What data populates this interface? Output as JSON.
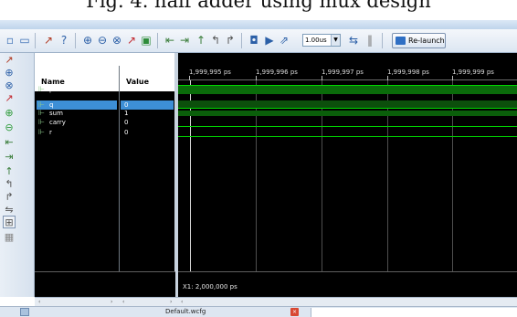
{
  "caption": {
    "text": "Fig. 4. half adder using mux design"
  },
  "toolbar": {
    "zoom_value": "1.00us",
    "relaunch_label": "Re-launch"
  },
  "columns": {
    "name": "Name",
    "value": "Value"
  },
  "signals": [
    {
      "name": "p",
      "value": "1"
    },
    {
      "name": "q",
      "value": "0"
    },
    {
      "name": "sum",
      "value": "1"
    },
    {
      "name": "carry",
      "value": "0"
    },
    {
      "name": "r",
      "value": "0"
    }
  ],
  "selected_signal": "q",
  "timeline": {
    "ticks": [
      "1,999,995 ps",
      "1,999,996 ps",
      "1,999,997 ps",
      "1,999,998 ps",
      "1,999,999 ps"
    ],
    "cursor_readout": "X1: 2,000,000 ps"
  },
  "tab": {
    "name": "Default.wcfg"
  },
  "colors": {
    "background": "#000000",
    "wave": "#00d600",
    "selection": "#3d8fd6"
  }
}
